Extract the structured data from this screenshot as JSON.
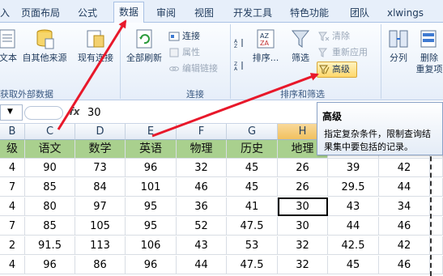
{
  "tabs": [
    "入",
    "页面布局",
    "公式",
    "数据",
    "审阅",
    "视图",
    "开发工具",
    "特色功能",
    "团队",
    "xlwings"
  ],
  "ribbon": {
    "btn_text": "文本",
    "btn_other": "自其他来源",
    "btn_existing": "现有连接",
    "group_external": "获取外部数据",
    "btn_refresh": "全部刷新",
    "btn_connections": "连接",
    "btn_properties": "属性",
    "btn_edit_links": "编辑链接",
    "group_connections": "连接",
    "btn_sort": "排序...",
    "btn_filter": "筛选",
    "btn_clear": "清除",
    "btn_reapply": "重新应用",
    "btn_advanced": "高级",
    "group_sort_filter": "排序和筛选",
    "btn_split": "分列",
    "btn_remove_dup_1": "删除",
    "btn_remove_dup_2": "重复项"
  },
  "formula_bar": {
    "fx": "fx",
    "value": "30"
  },
  "tooltip": {
    "title": "高级",
    "line1": "指定复杂条件，限制查询结",
    "line2": "果集中要包括的记录。"
  },
  "columns": [
    "B",
    "C",
    "D",
    "E",
    "F",
    "G",
    "H",
    "I",
    "J"
  ],
  "header_row": [
    "级",
    "语文",
    "数学",
    "英语",
    "物理",
    "历史",
    "地理",
    "",
    ""
  ],
  "rows": [
    [
      "4",
      "90",
      "73",
      "96",
      "32",
      "45",
      "26",
      "39",
      "42"
    ],
    [
      "7",
      "85",
      "84",
      "101",
      "46",
      "45",
      "26",
      "29.5",
      "44"
    ],
    [
      "4",
      "80",
      "97",
      "95",
      "36",
      "41",
      "30",
      "43",
      "34"
    ],
    [
      "7",
      "85",
      "105",
      "95",
      "52",
      "47.5",
      "30",
      "44",
      "46"
    ],
    [
      "2",
      "91.5",
      "113",
      "106",
      "43",
      "53",
      "32",
      "42.5",
      "42"
    ],
    [
      "4",
      "96",
      "86",
      "96",
      "44",
      "47.5",
      "32",
      "45",
      "46"
    ]
  ],
  "colors": {
    "header_fill": "#a9d08e",
    "arrow": "#e8182a",
    "selected_col": "#f1c15f"
  }
}
